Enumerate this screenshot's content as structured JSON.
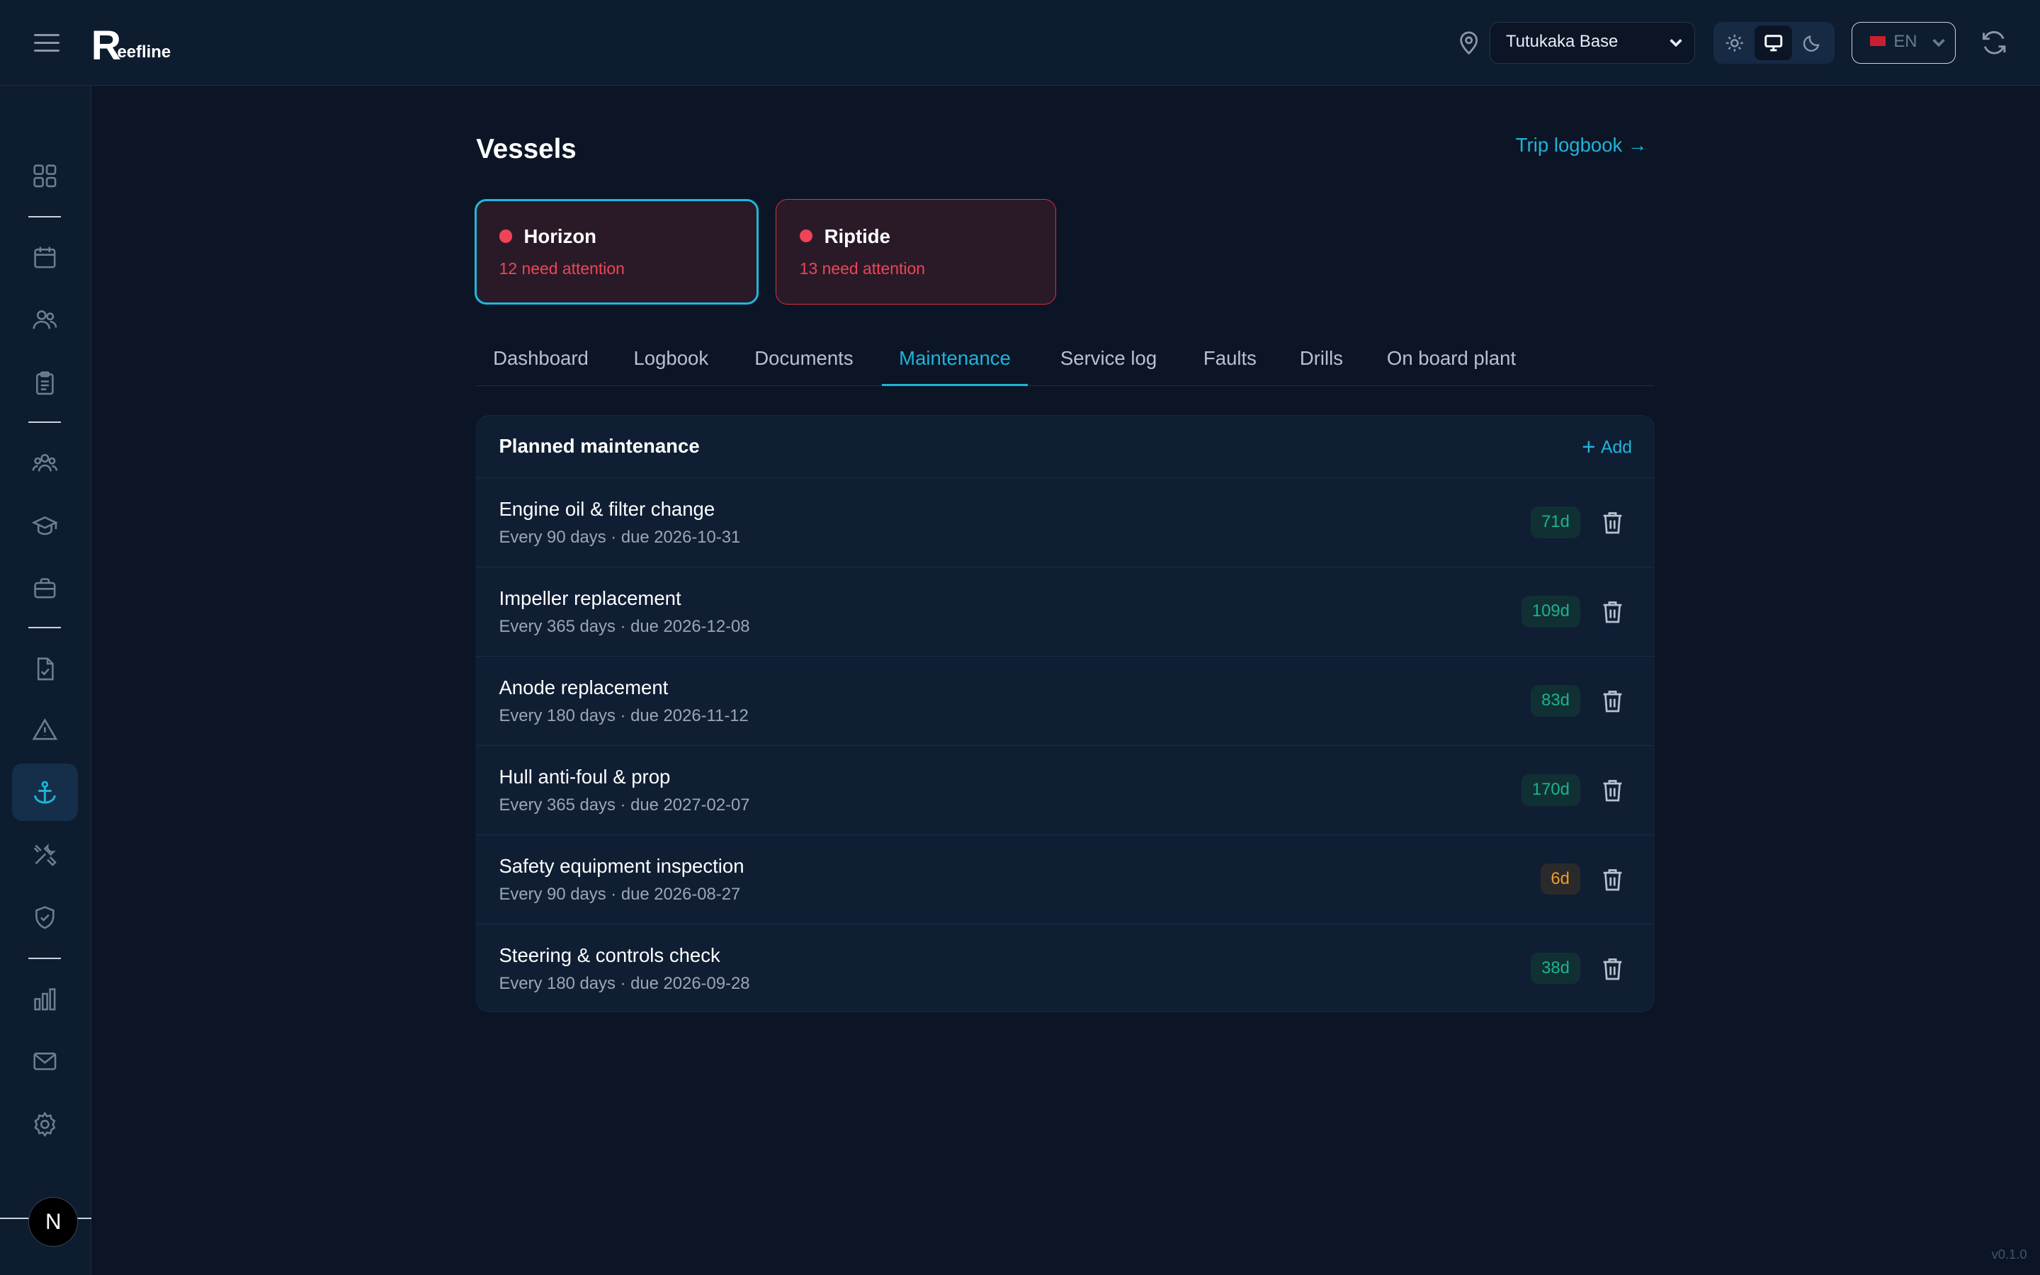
{
  "app": {
    "logo_initial": "R",
    "logo_rest": "eefline",
    "version": "v0.1.0",
    "user_initial": "N"
  },
  "header": {
    "base": "Tutukaka Base",
    "language": "EN"
  },
  "sidebar": {
    "icons": [
      "grid-icon",
      "calendar-icon",
      "users-icon",
      "clipboard-icon",
      "team-icon",
      "graduation-icon",
      "briefcase-icon",
      "document-check-icon",
      "warning-icon",
      "anchor-icon",
      "tools-icon",
      "shield-check-icon",
      "bar-chart-icon",
      "mail-icon",
      "gear-icon"
    ],
    "active": "anchor-icon"
  },
  "page": {
    "title": "Vessels",
    "trip_link": "Trip logbook →"
  },
  "vessels": [
    {
      "name": "Horizon",
      "attention": "12 need attention",
      "selected": true
    },
    {
      "name": "Riptide",
      "attention": "13 need attention",
      "selected": false
    }
  ],
  "tabs": [
    {
      "label": "Dashboard"
    },
    {
      "label": "Logbook"
    },
    {
      "label": "Documents"
    },
    {
      "label": "Maintenance",
      "active": true
    },
    {
      "label": "Service log"
    },
    {
      "label": "Faults"
    },
    {
      "label": "Drills"
    },
    {
      "label": "On board plant"
    }
  ],
  "maintenance": {
    "title": "Planned maintenance",
    "add_label": "Add",
    "items": [
      {
        "title": "Engine oil & filter change",
        "sub": "Every 90 days · due 2026-10-31",
        "badge": "71d",
        "status": "green"
      },
      {
        "title": "Impeller replacement",
        "sub": "Every 365 days · due 2026-12-08",
        "badge": "109d",
        "status": "green"
      },
      {
        "title": "Anode replacement",
        "sub": "Every 180 days · due 2026-11-12",
        "badge": "83d",
        "status": "green"
      },
      {
        "title": "Hull anti-foul & prop",
        "sub": "Every 365 days · due 2027-02-07",
        "badge": "170d",
        "status": "green"
      },
      {
        "title": "Safety equipment inspection",
        "sub": "Every 90 days · due 2026-08-27",
        "badge": "6d",
        "status": "orange"
      },
      {
        "title": "Steering & controls check",
        "sub": "Every 180 days · due 2026-09-28",
        "badge": "38d",
        "status": "green"
      }
    ]
  },
  "colors": {
    "accent": "#1fb4d8",
    "danger": "#ef4455",
    "ok": "#19b48a",
    "warn": "#f29a2b"
  }
}
